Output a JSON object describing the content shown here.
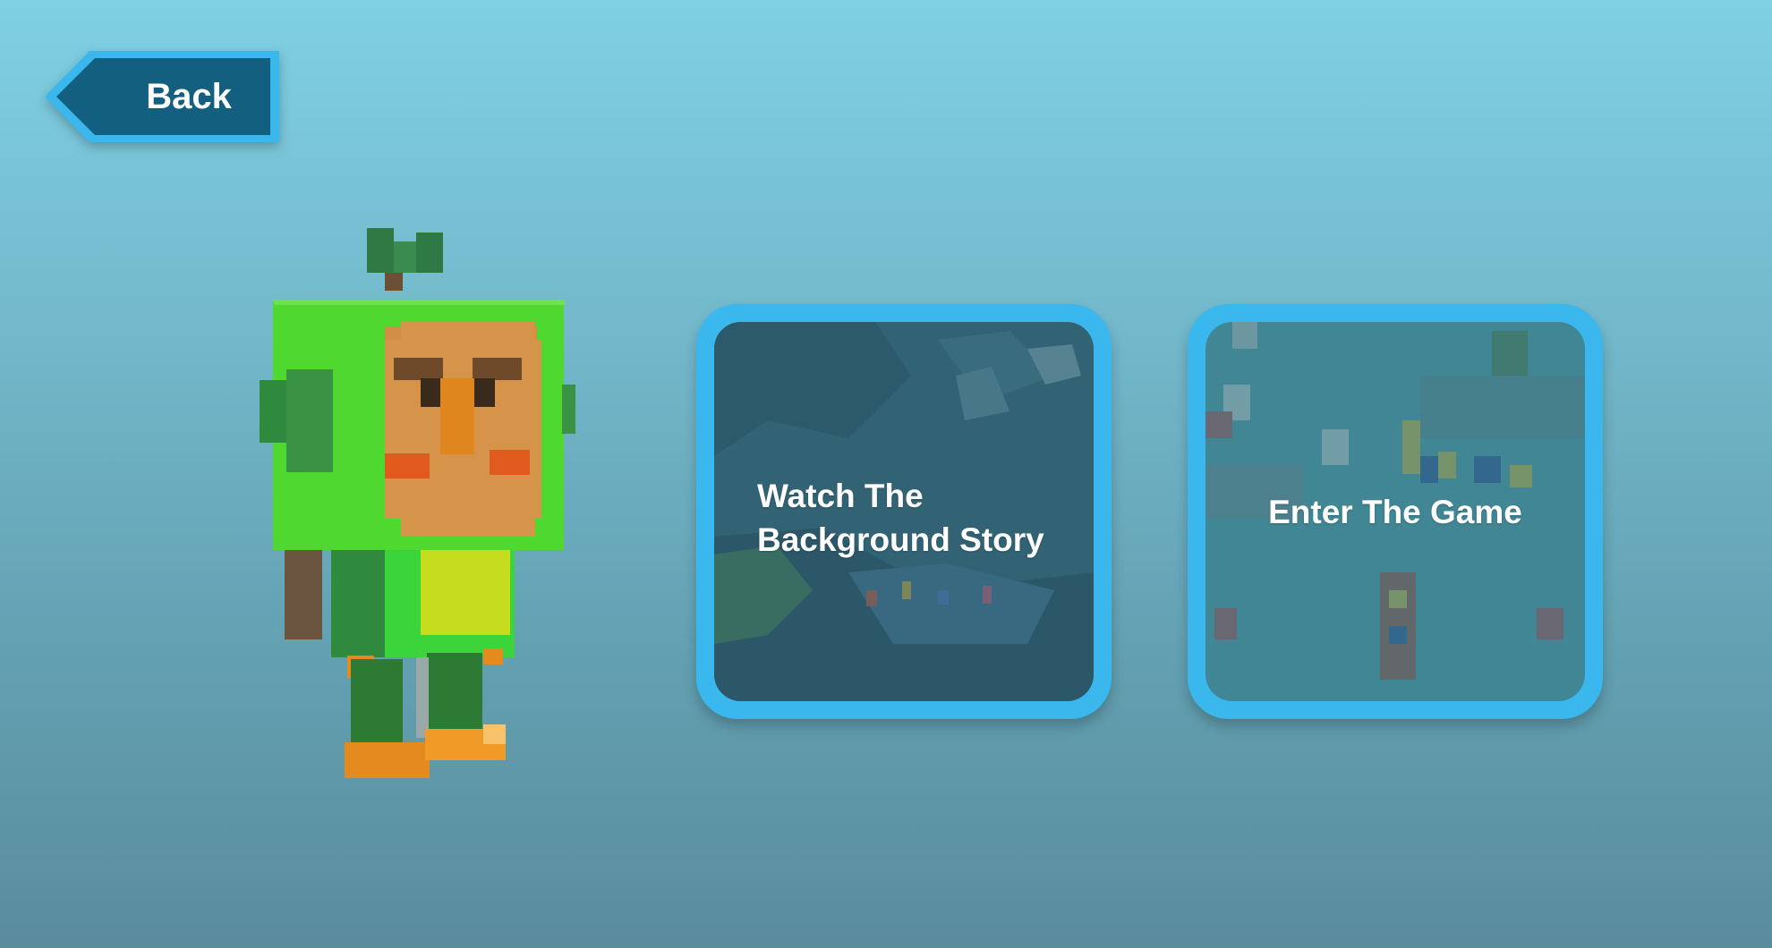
{
  "back_button": {
    "label": "Back"
  },
  "cards": {
    "story": {
      "line1": "Watch The",
      "line2": "Background Story"
    },
    "game": {
      "label": "Enter The Game"
    }
  },
  "colors": {
    "accent_blue": "#3ab8ee",
    "back_fill": "#125f80",
    "card_overlay": "#2f5f73"
  }
}
